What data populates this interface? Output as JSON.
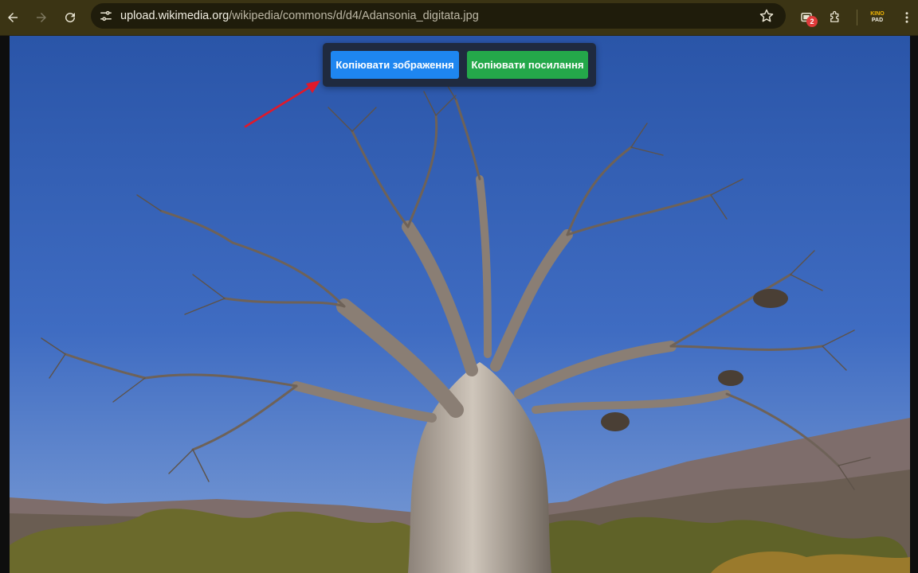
{
  "browser": {
    "url_host": "upload.wikimedia.org",
    "url_path": "/wikipedia/commons/d/d4/Adansonia_digitata.jpg",
    "extension_badge_count": "2",
    "kino_logo_line1": "KINO",
    "kino_logo_line2": "PAD",
    "icons": {
      "back": "arrow-left-icon",
      "forward": "arrow-right-icon",
      "reload": "reload-icon",
      "site_info": "tune-icon",
      "bookmark": "star-icon",
      "extension_badge": "tab-counter-icon",
      "extensions": "puzzle-icon",
      "menu": "kebab-menu-icon"
    }
  },
  "overlay": {
    "copy_image_label": "Копіювати зображення",
    "copy_link_label": "Копіювати посилання"
  },
  "colors": {
    "toolbar": "#3b3414",
    "omnibox": "#1f1c0b",
    "copy_image_button": "#1e86f0",
    "copy_link_button": "#24a84a",
    "overlay_panel": "#1f2a3f",
    "annotation_arrow": "#e0192a"
  }
}
